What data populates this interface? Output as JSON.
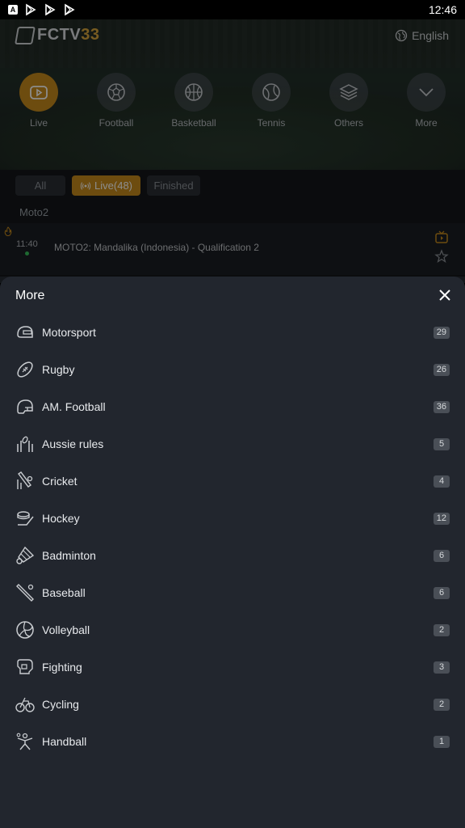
{
  "statusbar": {
    "time": "12:46",
    "notif_a": "A"
  },
  "header": {
    "brand_prefix": "FCTV",
    "brand_suffix": "33",
    "language": "English"
  },
  "categories": [
    {
      "label": "Live",
      "icon": "live-tv-icon",
      "active": true
    },
    {
      "label": "Football",
      "icon": "football-icon"
    },
    {
      "label": "Basketball",
      "icon": "basketball-icon"
    },
    {
      "label": "Tennis",
      "icon": "tennis-icon"
    },
    {
      "label": "Others",
      "icon": "layers-icon"
    },
    {
      "label": "More",
      "icon": "chevron-down-icon"
    }
  ],
  "filters": {
    "all": "All",
    "live": "Live(48)",
    "finished": "Finished"
  },
  "league": "Moto2",
  "match": {
    "time": "11:40",
    "title": "MOTO2: Mandalika (Indonesia) - Qualification 2"
  },
  "colors": {
    "accent": "#c68a1d",
    "sheet_bg": "#22262e",
    "live_dot": "#37c05a"
  },
  "more_sheet": {
    "title": "More",
    "items": [
      {
        "label": "Motorsport",
        "count": "29",
        "icon": "helmet-icon"
      },
      {
        "label": "Rugby",
        "count": "26",
        "icon": "rugby-ball-icon"
      },
      {
        "label": "AM. Football",
        "count": "36",
        "icon": "football-helmet-icon"
      },
      {
        "label": "Aussie rules",
        "count": "5",
        "icon": "aussie-rules-icon"
      },
      {
        "label": "Cricket",
        "count": "4",
        "icon": "cricket-icon"
      },
      {
        "label": "Hockey",
        "count": "12",
        "icon": "hockey-icon"
      },
      {
        "label": "Badminton",
        "count": "6",
        "icon": "shuttlecock-icon"
      },
      {
        "label": "Baseball",
        "count": "6",
        "icon": "baseball-bat-icon"
      },
      {
        "label": "Volleyball",
        "count": "2",
        "icon": "volleyball-icon"
      },
      {
        "label": "Fighting",
        "count": "3",
        "icon": "boxing-glove-icon"
      },
      {
        "label": "Cycling",
        "count": "2",
        "icon": "cycling-icon"
      },
      {
        "label": "Handball",
        "count": "1",
        "icon": "handball-icon"
      }
    ]
  }
}
